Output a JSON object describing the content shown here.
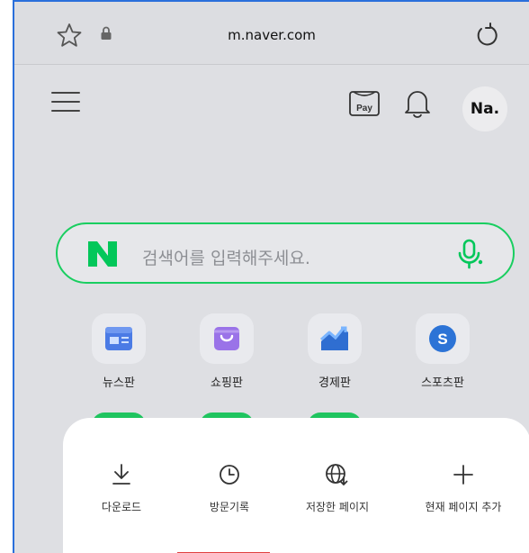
{
  "browser": {
    "url": "m.naver.com",
    "icons": [
      "star-icon",
      "lock-icon",
      "reload-icon"
    ]
  },
  "header": {
    "pay_label": "Pay",
    "profile_initials": "Na.",
    "icons": [
      "menu-icon",
      "pay-icon",
      "bell-icon"
    ]
  },
  "search": {
    "logo_letter": "N",
    "placeholder": "검색어를 입력해주세요.",
    "accent_color": "#19ce60",
    "icons": [
      "naver-logo-icon",
      "microphone-icon"
    ]
  },
  "shortcuts": [
    {
      "label": "뉴스판",
      "icon": "news-icon"
    },
    {
      "label": "쇼핑판",
      "icon": "shopping-bag-icon"
    },
    {
      "label": "경제판",
      "icon": "chart-trend-icon"
    },
    {
      "label": "스포츠판",
      "icon": "sports-icon"
    }
  ],
  "sheet": {
    "items": [
      {
        "label": "다운로드",
        "icon": "download-icon"
      },
      {
        "label": "방문기록",
        "icon": "clock-icon"
      },
      {
        "label": "저장한 페이지",
        "icon": "saved-globe-icon"
      },
      {
        "label": "현재 페이지 추가",
        "icon": "plus-icon"
      }
    ]
  }
}
